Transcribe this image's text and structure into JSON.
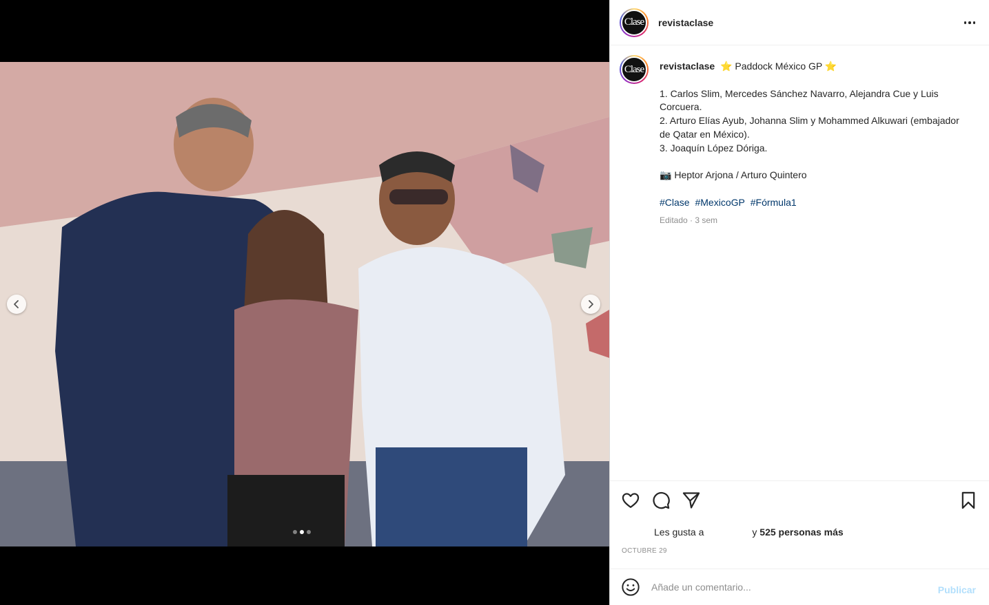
{
  "post": {
    "username": "revistaclase",
    "avatar_text": "Clase",
    "media": {
      "slide_count": 3,
      "active_slide": 2,
      "prev_icon": "chevron-left-icon",
      "next_icon": "chevron-right-icon"
    },
    "caption": {
      "username": "revistaclase",
      "star": "⭐",
      "title": "Paddock México GP",
      "lines": [
        "1. Carlos Slim, Mercedes Sánchez Navarro, Alejandra Cue y Luis Corcuera.",
        "2. Arturo Elías Ayub, Johanna Slim y Mohammed Alkuwari (embajador de Qatar en México).",
        "3. Joaquín López Dóriga."
      ],
      "camera": "📷",
      "credit": "Heptor Arjona / Arturo Quintero",
      "hashtags": [
        "#Clase",
        "#MexicoGP",
        "#Fórmula1"
      ],
      "meta": "Editado · 3 sem"
    },
    "actions": {
      "like_icon": "heart-icon",
      "comment_icon": "comment-icon",
      "share_icon": "send-icon",
      "save_icon": "bookmark-icon"
    },
    "likes": {
      "prefix": "Les gusta a",
      "suffix": "y",
      "count_text": "525 personas más"
    },
    "date": "OCTUBRE 29",
    "comment_box": {
      "placeholder": "Añade un comentario...",
      "post_label": "Publicar",
      "emoji_icon": "smiley-icon"
    }
  },
  "colors": {
    "hashtag": "#00376b",
    "secondary_text": "#8e8e8e",
    "post_button_disabled": "#b2dffc"
  }
}
